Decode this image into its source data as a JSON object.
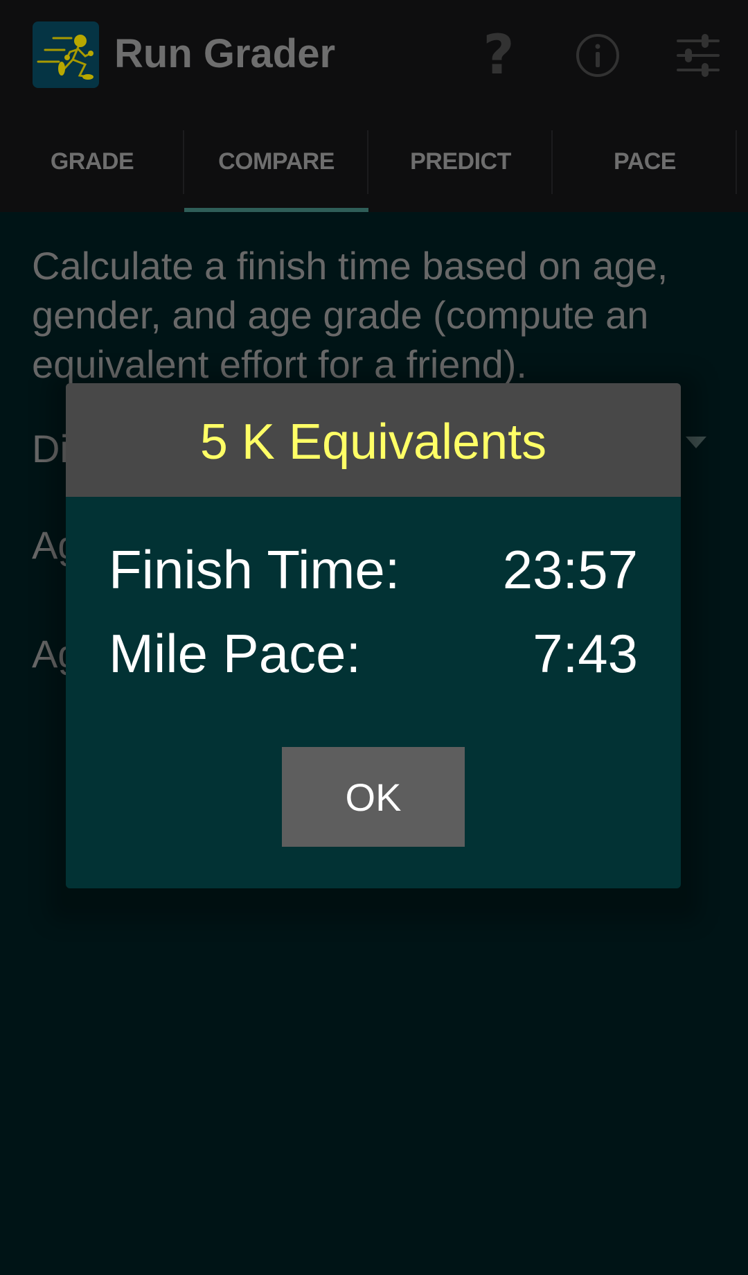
{
  "app": {
    "title": "Run Grader",
    "logo_icon": "running-man-icon",
    "actions": [
      {
        "name": "help",
        "icon": "question-mark-icon",
        "glyph": "?"
      },
      {
        "name": "info",
        "icon": "info-circle-icon",
        "glyph": "i"
      },
      {
        "name": "settings",
        "icon": "sliders-icon"
      }
    ]
  },
  "tabs": [
    {
      "label": "GRADE",
      "active": false
    },
    {
      "label": "COMPARE",
      "active": true
    },
    {
      "label": "PREDICT",
      "active": false
    },
    {
      "label": "PACE",
      "active": false
    }
  ],
  "content": {
    "description": "Calculate a finish time based on age, gender, and age grade (compute an equivalent effort for a friend).",
    "partial_labels": [
      "Di",
      "Ag",
      "Ag"
    ]
  },
  "dialog": {
    "title": "5 K Equivalents",
    "rows": [
      {
        "label": "Finish Time:",
        "value": "23:57"
      },
      {
        "label": "Mile Pace:",
        "value": "7:43"
      }
    ],
    "ok_label": "OK"
  },
  "colors": {
    "dialog_title": "#ffff66",
    "dialog_body": "#023234",
    "dialog_header": "#484848",
    "tab_indicator": "#2f5e58",
    "logo_bg": "#053444",
    "logo_figure": "#b8a800"
  }
}
